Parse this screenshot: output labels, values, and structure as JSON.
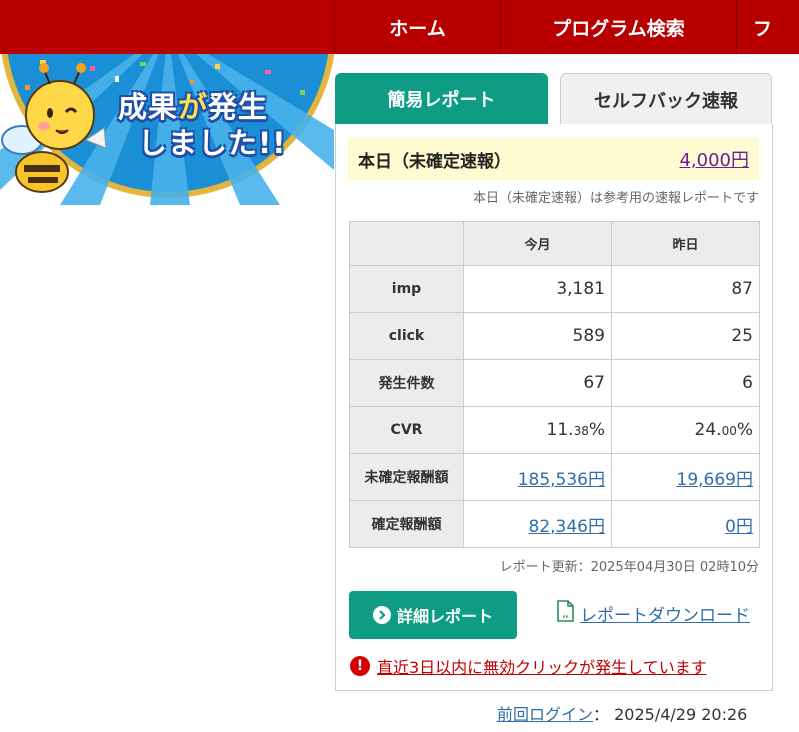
{
  "nav": {
    "home": "ホーム",
    "program_search": "プログラム検索",
    "more": "フ"
  },
  "banner": {
    "line1_a": "成果",
    "line1_b": "が",
    "line1_c": "発生",
    "line2": "しました!!"
  },
  "tabs": {
    "simple_report": "簡易レポート",
    "selfback": "セルフバック速報"
  },
  "today": {
    "label": "本日（未確定速報）",
    "value": "4,000円",
    "note": "本日（未確定速報）は参考用の速報レポートです"
  },
  "table": {
    "headers": [
      "今月",
      "昨日"
    ],
    "rows": [
      {
        "label": "imp",
        "month": "3,181",
        "yesterday": "87"
      },
      {
        "label": "click",
        "month": "589",
        "yesterday": "25"
      },
      {
        "label": "発生件数",
        "month": "67",
        "yesterday": "6"
      },
      {
        "label": "CVR",
        "month_int": "11.",
        "month_dec": "38",
        "month_unit": "%",
        "yest_int": "24.",
        "yest_dec": "00",
        "yest_unit": "%"
      },
      {
        "label": "未確定報酬額",
        "month": "185,536円",
        "yesterday": "19,669円"
      },
      {
        "label": "確定報酬額",
        "month": "82,346円",
        "yesterday": "0円"
      }
    ]
  },
  "update_text": "レポート更新：2025年04月30日 02時10分",
  "buttons": {
    "detail_report": "詳細レポート",
    "download": "レポートダウンロード"
  },
  "warning": "直近3日以内に無効クリックが発生しています",
  "last_login": {
    "label": "前回ログイン",
    "sep": "：",
    "value": "2025/4/29 20:26"
  },
  "colors": {
    "nav_red": "#b80000",
    "accent_green": "#0f9c85",
    "link_blue": "#2f6ea8",
    "warn_red": "#d60000"
  }
}
